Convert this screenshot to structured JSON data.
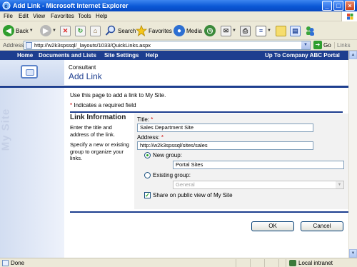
{
  "window": {
    "title": "Add Link - Microsoft Internet Explorer",
    "minimize": "_",
    "maximize": "□",
    "close": "×"
  },
  "menu": [
    "File",
    "Edit",
    "View",
    "Favorites",
    "Tools",
    "Help"
  ],
  "toolbar": {
    "back": "Back",
    "search": "Search",
    "favorites": "Favorites",
    "media": "Media"
  },
  "address": {
    "label": "Address",
    "url": "http://w2k3spssql/_layouts/1033/QuickLinks.aspx",
    "go": "Go",
    "links": "Links"
  },
  "nav": {
    "home": "Home",
    "documents": "Documents and Lists",
    "settings": "Site Settings",
    "help": "Help",
    "up": "Up To Company ABC Portal"
  },
  "header": {
    "site": "Consultant",
    "title": "Add Link"
  },
  "sidebar": {
    "vertical_text": "My Site"
  },
  "content": {
    "intro": "Use this page to add a link to My Site.",
    "required_marker": "*",
    "required_text": " Indicates a required field",
    "section_title": "Link Information",
    "section_desc1": "Enter the title and address of the link.",
    "section_desc2": "Specify a new or existing group to organize your links."
  },
  "form": {
    "title_label": "Title:",
    "title_value": "Sales Department Site",
    "address_label": "Address:",
    "address_value": "http://w2k3spssql/sites/sales",
    "new_group_label": "New group:",
    "new_group_value": "Portal Sites",
    "existing_group_label": "Existing group:",
    "existing_group_value": "General",
    "share_label": "Share on public view of My Site",
    "selected_group_option": "new",
    "share_checked": true
  },
  "buttons": {
    "ok": "OK",
    "cancel": "Cancel"
  },
  "status": {
    "text": "Done",
    "zone": "Local intranet"
  },
  "colors": {
    "title_bar": "#0a58d6",
    "nav_bar": "#1d3e8f",
    "required": "#cc0000",
    "chrome": "#ece9d8"
  }
}
